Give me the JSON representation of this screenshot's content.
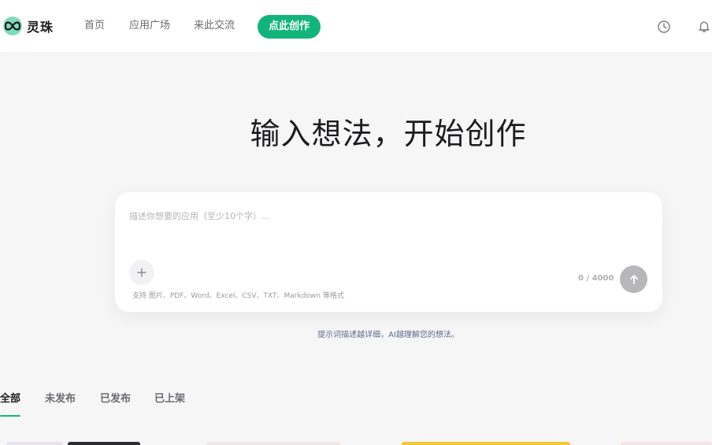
{
  "header": {
    "app_name": "灵珠",
    "nav": {
      "home": "首页",
      "plaza": "应用广场",
      "community": "来此交流"
    },
    "create_label": "点此创作",
    "icons": [
      "infinity-logo-icon",
      "history-clock-icon",
      "bell-icon"
    ]
  },
  "hero": {
    "title": "输入想法，开始创作"
  },
  "prompt": {
    "placeholder": "描述你想要的应用（至少10个字）...",
    "value": "",
    "upload_hint": "支持 图片、PDF、Word、Excel、CSV、TXT、Markdown 等格式",
    "char_count": "0 / 4000",
    "icons": [
      "plus-icon",
      "arrow-up-icon"
    ]
  },
  "tip": "提示词描述越详细，AI越理解您的想法。",
  "tabs": {
    "all": "全部",
    "unpublished": "未发布",
    "published": "已发布",
    "listed": "已上架",
    "active": "全部"
  },
  "colors": {
    "accent": "#13b47c",
    "logo": "#7fdcbe",
    "background": "#f6f6f7",
    "send_disabled": "#b7b7ba"
  }
}
